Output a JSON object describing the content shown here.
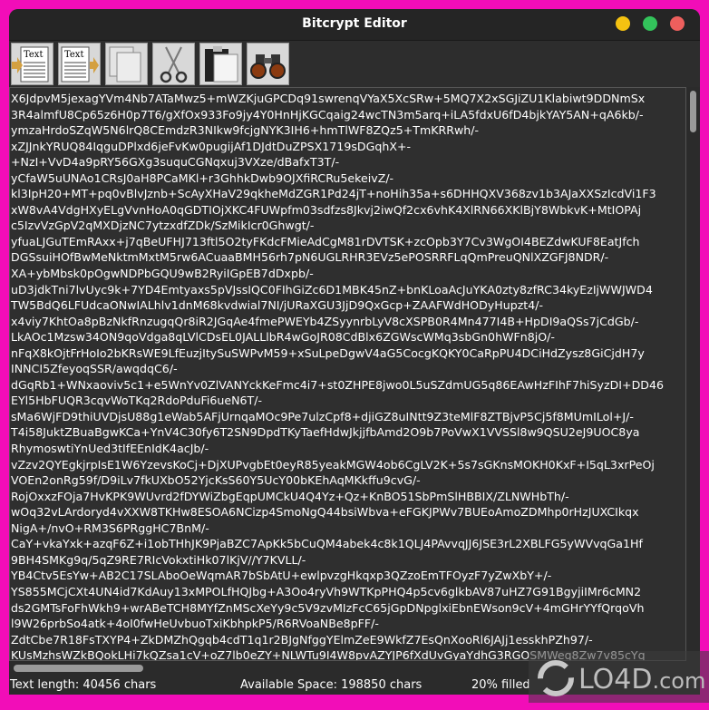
{
  "window": {
    "title": "Bitcrypt Editor",
    "controls": [
      {
        "name": "minimize",
        "color": "#f5c211"
      },
      {
        "name": "maximize",
        "color": "#33c35b"
      },
      {
        "name": "close",
        "color": "#ed5f5d"
      }
    ]
  },
  "toolbar": [
    {
      "name": "import-text",
      "icon": "text-document-arrow-in-icon",
      "label": "Text"
    },
    {
      "name": "export-text",
      "icon": "text-document-arrow-out-icon",
      "label": "Text"
    },
    {
      "name": "copy",
      "icon": "copy-icon"
    },
    {
      "name": "cut",
      "icon": "scissors-icon"
    },
    {
      "name": "paste",
      "icon": "clipboard-icon"
    },
    {
      "name": "find",
      "icon": "binoculars-icon"
    }
  ],
  "editor": {
    "lines": [
      "X6JdpvM5jexagYVm4Nb7ATaMwz5+mWZKjuGPCDq91swrenqVYaX5XcSRw+5MQ7X2xSGJiZU1Klabiwt9DDNmSx",
      "3R4almfU8Cp65z6H0p7T6/gXfOx933Fo9jy4Y0HnHjKGCqaig24wcTN3m5arq+iLA5fdxU6fD4bjkYAY5AN+qA6kb/-",
      "ymzaHrdoSZqW5N6lrQ8CEmdzR3NIkw9fcjgNYK3IH6+hmTlWF8ZQz5+TmKRRwh/-",
      "xZJJnkYRUQ84IqguDPlxd6jeFvKw0pugijAf1DJdtDuZPSX1719sDGqhX+-",
      "+NzI+VvD4a9pRY56GXg3suquCGNqxuj3VXze/dBafxT3T/-",
      "yCfaW5uUNAo1CRsJ0aH8PCaMKl+r3GhhkDwb9OJXfiRCRu5ekeivZ/-",
      "kl3IpH20+MT+pq0vBlvJznb+ScAyXHaV29qkheMdZGR1Pd24jT+noHih35a+s6DHHQXV368zv1b3AJaXXSzIcdVi1F3",
      "xW8vA4VdgHXyELgVvnHoA0qGDTIOjXKC4FUWpfm03sdfzs8Jkvj2iwQf2cx6vhK4XlRN66XKlBjY8WbkvK+MtIOPAj",
      "c5IzvVzGpV2qMXDjzNC7ytzxdfZDk/SzMikIcr0Ghwgt/-",
      "yfuaLJGuTEmRAxx+j7qBeUFHJ713ftl5O2tyFKdcFMieAdCgM81rDVTSK+zcOpb3Y7Cv3WgOI4BEZdwKUF8EatJfch",
      "DGSsuiHOfBwMeNktmMxtM5rw6ACuaaBMH56rh7pN6UGLRHR3EVz5ePOSRRFLqQmPreuQNlXZGFJ8NDR/-",
      "XA+ybMbsk0pOgwNDPbGQU9wB2RyiIGpEB7dDxpb/-",
      "uD3jdkTni7lvUyc9k+7YD4Emtyaxs5pVJssIQC0FIhGiZc6D1MBK45nZ+bnKLoaAcJuYKA0zty8zfRC34kyEzIjWWJWD4",
      "TW5BdQ6LFUdcaONwIALhlv1dnM68kvdwial7NI/jURaXGU3JjD9QxGcp+ZAAFWdHODyHupzt4/-",
      "x4viy7KhtOa8pBzNkfRnzugqQr8iR2JGqAe4fmePWEYb4ZSyynrbLyV8cXSPB0R4Mn477I4B+HpDI9aQSs7jCdGb/-",
      "LkAOc1Mzsw34ON9qoVdga8qLVlCDsEL0JALLlbR4wGoJR08CdBlx6ZGWscWMq3sbGn0hWFn8jO/-",
      "nFqX8kOjtFrHoIo2bKRsWE9LfEuzjItySuSWPvM59+xSuLpeDgwV4aG5CocgKQKY0CaRpPU4DCiHdZysz8GiCjdH7y",
      "INNCI5ZfeyoqSSR/awqdqC6/-",
      "dGqRb1+WNxaoviv5c1+e5WnYv0ZlVANYckKeFmc4i7+st0ZHPE8jwo0L5uSZdmUG5q86EAwHzFIhF7hiSyzDI+DD46",
      "EYl5HbFUQR3cqvWoTKq2RdoPduFi6ueN6T/-",
      "sMa6WjFD9thiUVDjsU88g1eWab5AFjUrnqaMOc9Pe7ulzCpf8+djiGZ8uINtt9Z3teMlF8ZTBjvP5Cj5f8MUmILol+J/-",
      "T4i58JuktZBuaBgwKCa+YnV4C30fy6T2SN9DpdTKyTaefHdwJkjjfbAmd2O9b7PoVwX1VVSSl8w9QSU2eJ9UOC8ya",
      "RhymoswtiYnUed3tIfEEnIdK4acJb/-",
      "vZzv2QYEgkjrpIsE1W6YzevsKoCj+DjXUPvgbEt0eyR85yeakMGW4ob6CgLV2K+5s7sGKnsMOKH0KxF+I5qL3xrPeOj",
      "VOEn2onRg59f/D9iLv7fkUXbO52YjcKsS60Y5UcY00bKEhAqMKkffu9cvG/-",
      "RojOxxzFOja7HvKPK9WUvrd2fDYWiZbgEqpUMCkU4Q4Yz+Qz+KnBO51SbPmSlHBBIX/ZLNWHbTh/-",
      "wOq32vLArdoryd4vXXW8TKHw8ESOA6NCizp4SmoNgQ44bsiWbva+eFGKJPWv7BUEoAmoZDMhp0rHzJUXCIkqx",
      "NigA+/nvO+RM3S6PRggHC7BnM/-",
      "CaY+vkaYxk+azqF6Z+i1obTHhJK9PjaBZC7ApKk5bCuQM4abek4c8k1QLJ4PAvvqJJ6JSE3rL2XBLFG5yWVvqGa1Hf",
      "9BH4SMKg9q/5qZ9RE7RIcVokxtiHk07lKjV//Y7KVLL/-",
      "YB4Ctv5EsYw+AB2C17SLAboOeWqmAR7bSbAtU+ewlpvzgHkqxp3QZzoEmTFOyzF7yZwXbY+/-",
      "YS855MCjCXt4UN4id7KdAuy13xMPOLfHQJbg+A3Oo4ryVh9WTKpPHQ4p5cv6glkbAV87uHZ7G91BgyjiIMr6cMN2",
      "ds2GMTsFoFhWkh9+wrABeTCH8MYfZnMScXeYy9c5V9zvMIzFcC65jGpDNpglxiEbnEWson9cV+4mGHrYYfQrqoVh",
      "l9W26prbSo4atk+4oI0fwHeUvbuoTxiKbhpkP5/R6RVoaNBe8pFF/-",
      "ZdtCbe7R18FsTXYP4+ZkDMZhQgqb4cdT1q1r2BJgNfggYElmZeE9WkfZ7EsQnXooRl6JAJj1esskhPZh97/-",
      "KUsMzhsWZkBQokLHi7kQZsa1cV+oZ7lb0eZY+NLWTu9I4W8pvAZYJP6fXdUvGyaYdhG3RGOSMWeq8Zw7v85cYq",
      "PhfIEqxtr4jYHDfdgIJBeMnzlP77fzXVpjSm0UYcf0j3Ig3wBJlB0uYK7QysnMHBur1ol183XvBpMIZ8AGi44yIWP+MDZ"
    ]
  },
  "status": {
    "text_length": "Text length: 40456 chars",
    "available": "Available Space: 198850 chars",
    "filled": "20% filled",
    "filled_percent": 20
  },
  "watermark": "LO4D.com"
}
